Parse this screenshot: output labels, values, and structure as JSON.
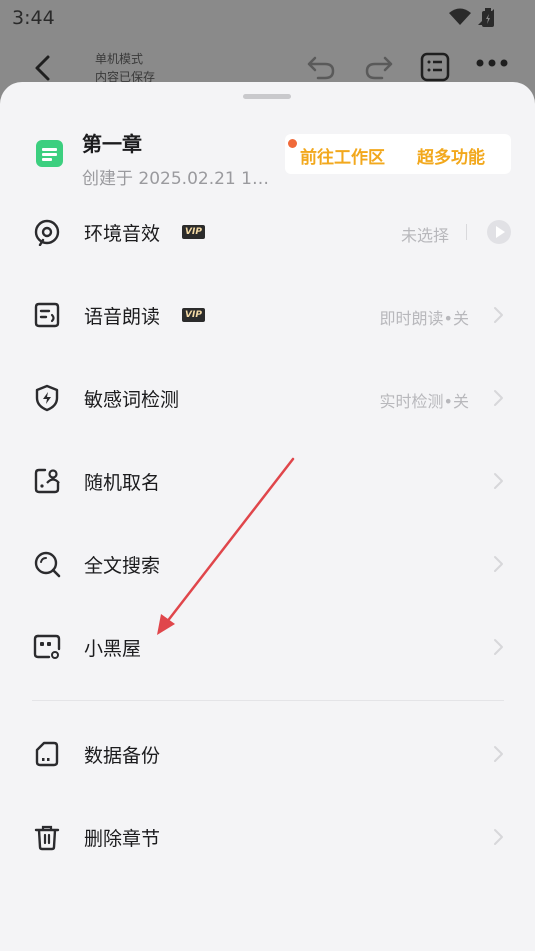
{
  "status_bar": {
    "time": "3:44"
  },
  "background_app": {
    "title_line1": "单机模式",
    "title_line2": "内容已保存"
  },
  "chapter": {
    "title": "第一章",
    "created": "创建于 2025.02.21 1…"
  },
  "promo": {
    "workspace_link": "前往工作区",
    "more_features_link": "超多功能"
  },
  "menu": {
    "items": [
      {
        "label": "环境音效",
        "vip": "VIP",
        "value": "未选择",
        "icon": "ambient-sound-icon"
      },
      {
        "label": "语音朗读",
        "vip": "VIP",
        "value": "即时朗读•关",
        "icon": "read-aloud-icon"
      },
      {
        "label": "敏感词检测",
        "value": "实时检测•关",
        "icon": "shield-lightning-icon"
      },
      {
        "label": "随机取名",
        "icon": "random-name-icon"
      },
      {
        "label": "全文搜索",
        "icon": "search-icon"
      },
      {
        "label": "小黑屋",
        "icon": "dark-room-icon"
      },
      {
        "label": "数据备份",
        "icon": "sd-card-icon"
      },
      {
        "label": "删除章节",
        "icon": "trash-icon"
      }
    ]
  },
  "colors": {
    "accent_orange": "#f2a81d",
    "doc_green": "#3ccf7f",
    "arrow_red": "#e0464b"
  }
}
